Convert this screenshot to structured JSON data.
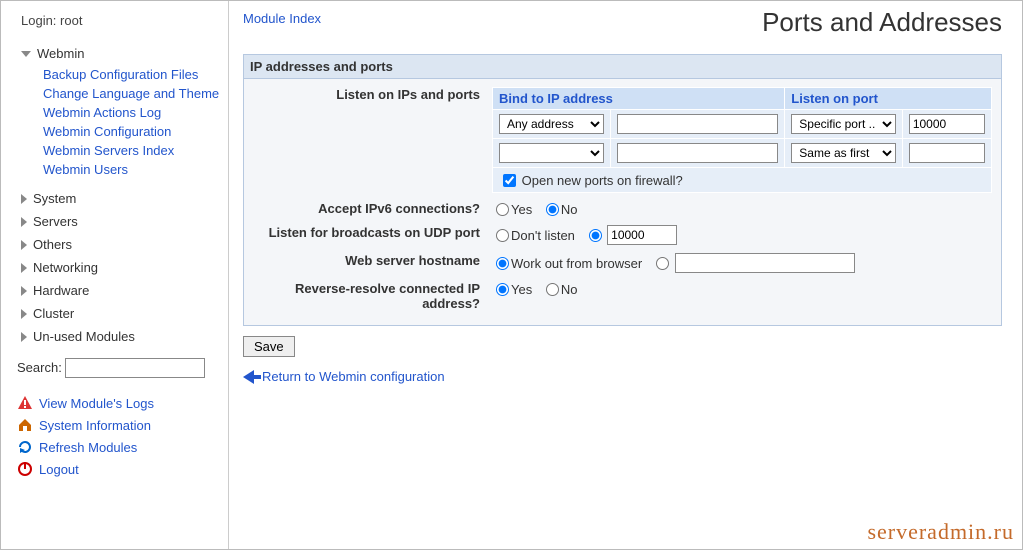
{
  "login_prefix": "Login:",
  "login_user": "root",
  "sidebar": {
    "expanded": {
      "label": "Webmin",
      "items": [
        "Backup Configuration Files",
        "Change Language and Theme",
        "Webmin Actions Log",
        "Webmin Configuration",
        "Webmin Servers Index",
        "Webmin Users"
      ]
    },
    "cats": [
      "System",
      "Servers",
      "Others",
      "Networking",
      "Hardware",
      "Cluster",
      "Un-used Modules"
    ],
    "search_label": "Search:",
    "search_value": "",
    "links": [
      {
        "icon": "warn",
        "label": "View Module's Logs"
      },
      {
        "icon": "home",
        "label": "System Information"
      },
      {
        "icon": "refresh",
        "label": "Refresh Modules"
      },
      {
        "icon": "power",
        "label": "Logout"
      }
    ]
  },
  "top": {
    "module_index": "Module Index",
    "title": "Ports and Addresses"
  },
  "section": {
    "head": "IP addresses and ports",
    "row1": {
      "label": "Listen on IPs and ports",
      "col_bind": "Bind to IP address",
      "col_port": "Listen on port",
      "bind_options": [
        "Any address",
        ""
      ],
      "bind_selected": [
        "Any address",
        ""
      ],
      "ip_values": [
        "",
        ""
      ],
      "port_mode_options": [
        "Specific port ..",
        "Same as first"
      ],
      "port_mode_selected": [
        "Specific port ..",
        "Same as first"
      ],
      "port_values": [
        "10000",
        ""
      ],
      "firewall_label": "Open new ports on firewall?",
      "firewall_checked": true
    },
    "row2": {
      "label": "Accept IPv6 connections?",
      "yes": "Yes",
      "no": "No",
      "selected": "no"
    },
    "row3": {
      "label": "Listen for broadcasts on UDP port",
      "opt1": "Don't listen",
      "opt2_value": "10000",
      "selected": "port"
    },
    "row4": {
      "label": "Web server hostname",
      "opt1": "Work out from browser",
      "opt2_value": "",
      "selected": "auto"
    },
    "row5": {
      "label": "Reverse-resolve connected IP address?",
      "yes": "Yes",
      "no": "No",
      "selected": "yes"
    }
  },
  "save": "Save",
  "return": "Return to Webmin configuration",
  "watermark": "serveradmin.ru"
}
